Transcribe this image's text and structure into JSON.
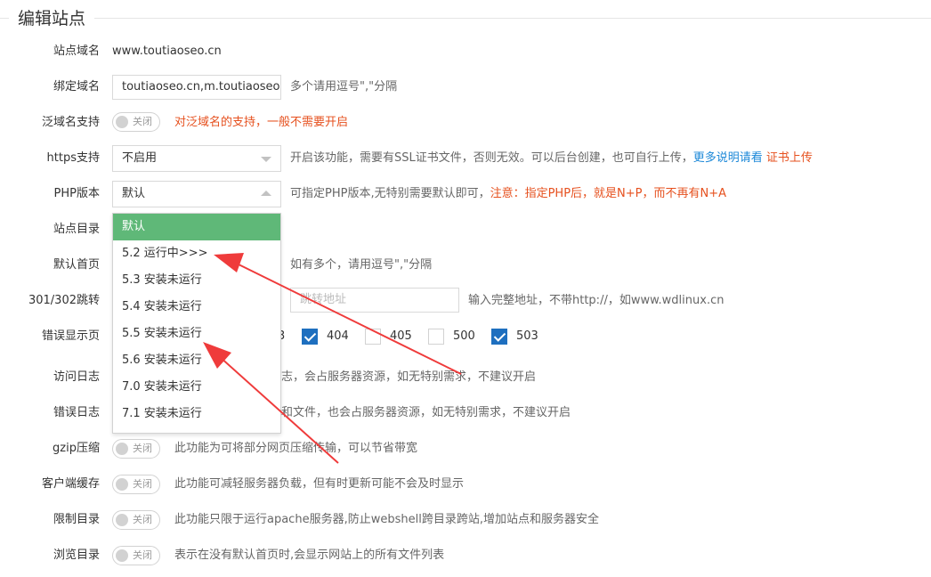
{
  "section": {
    "title": "编辑站点"
  },
  "domain": {
    "label": "站点域名",
    "value": "www.toutiaoseo.cn"
  },
  "bind": {
    "label": "绑定域名",
    "value": "toutiaoseo.cn,m.toutiaoseo.cn",
    "hint": "多个请用逗号\",\"分隔"
  },
  "wildcard": {
    "label": "泛域名支持",
    "state": "关闭",
    "hint": "对泛域名的支持，一般不需要开启"
  },
  "https": {
    "label": "https支持",
    "selected": "不启用",
    "hint": "开启该功能，需要有SSL证书文件，否则无效。可以后台创建，也可自行上传，",
    "link_more": "更多说明请看",
    "link_upload": "证书上传"
  },
  "php": {
    "label": "PHP版本",
    "selected": "默认",
    "hint": "可指定PHP版本,无特别需要默认即可，",
    "warn": "注意：指定PHP后，就是N+P，而不再有N+A",
    "options": [
      "默认",
      "5.2 运行中>>>",
      "5.3 安装未运行",
      "5.4 安装未运行",
      "5.5 安装未运行",
      "5.6 安装未运行",
      "7.0 安装未运行",
      "7.1 安装未运行"
    ]
  },
  "root_dir": {
    "label": "站点目录"
  },
  "index": {
    "label": "默认首页",
    "hint": "如有多个，请用逗号\",\"分隔"
  },
  "redirect": {
    "label": "301/302跳转",
    "placeholder": "跳转地址",
    "hint": "输入完整地址，不带http://，如www.wdlinux.cn"
  },
  "errpage": {
    "label": "错误显示页",
    "codes": [
      {
        "code": "3",
        "checked": false
      },
      {
        "code": "404",
        "checked": true
      },
      {
        "code": "405",
        "checked": false
      },
      {
        "code": "500",
        "checked": false
      },
      {
        "code": "503",
        "checked": true
      }
    ]
  },
  "access_log": {
    "label": "访问日志",
    "hint": "志，会占服务器资源，如无特别需求，不建议开启"
  },
  "error_log": {
    "label": "错误日志",
    "hint": "和文件，也会占服务器资源，如无特别需求，不建议开启"
  },
  "gzip": {
    "label": "gzip压缩",
    "state": "关闭",
    "hint": "此功能为可将部分网页压缩传输，可以节省带宽"
  },
  "client_cache": {
    "label": "客户端缓存",
    "state": "关闭",
    "hint": "此功能可减轻服务器负载，但有时更新可能不会及时显示"
  },
  "restrict_dir": {
    "label": "限制目录",
    "state": "关闭",
    "hint": "此功能只限于运行apache服务器,防止webshell跨目录跨站,增加站点和服务器安全"
  },
  "browse_dir": {
    "label": "浏览目录",
    "state": "关闭",
    "hint": "表示在没有默认首页时,会显示网站上的所有文件列表"
  },
  "colors": {
    "accent_green": "#5fb878",
    "warn_red": "#e6501e",
    "link_blue": "#1c88d8",
    "arrow_red": "#ef3b3b"
  }
}
